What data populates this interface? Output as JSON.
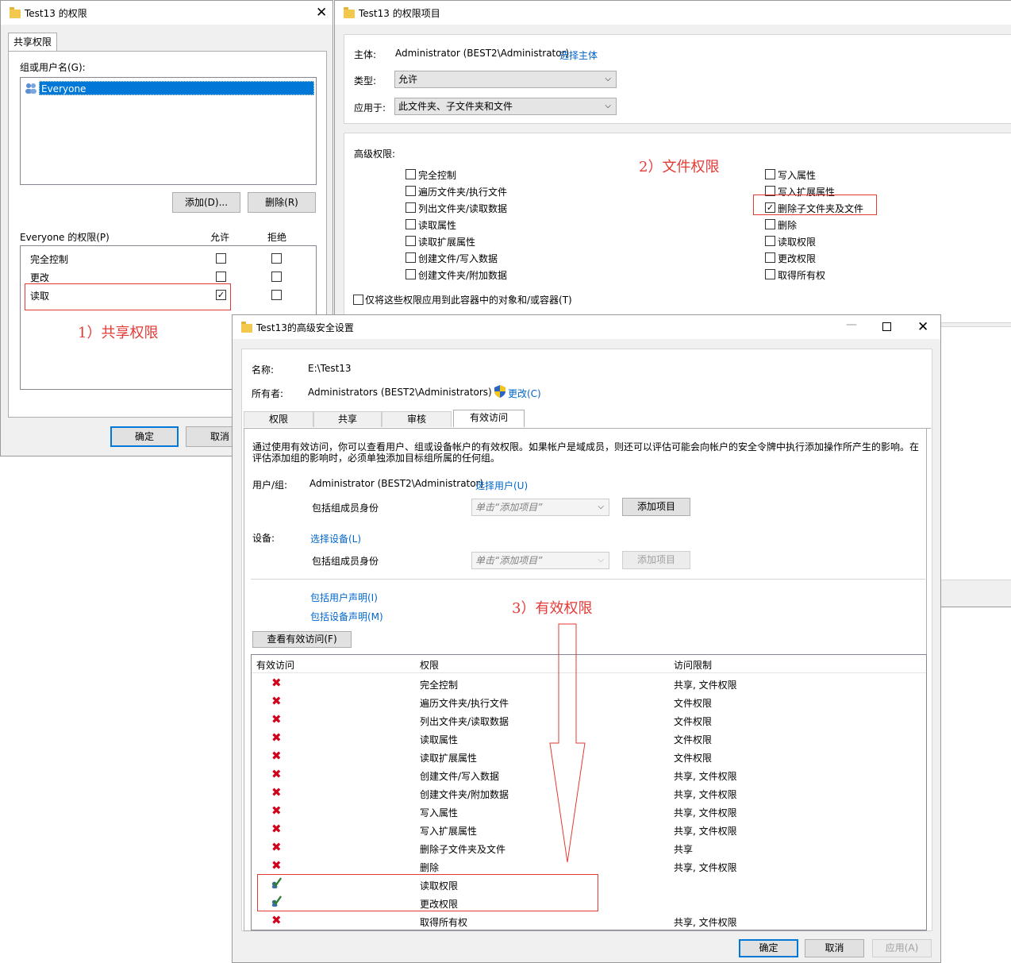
{
  "share_window": {
    "title": "Test13 的权限",
    "tab": "共享权限",
    "group_label": "组或用户名(G):",
    "users": [
      "Everyone"
    ],
    "add_button": "添加(D)...",
    "remove_button": "删除(R)",
    "perm_header": "Everyone 的权限(P)",
    "allow_header": "允许",
    "deny_header": "拒绝",
    "perms": [
      {
        "name": "完全控制",
        "allow": "",
        "deny": ""
      },
      {
        "name": "更改",
        "allow": "",
        "deny": ""
      },
      {
        "name": "读取",
        "allow": "✓",
        "deny": ""
      }
    ],
    "ok_button": "确定",
    "cancel_button": "取消",
    "annotation": "1）共享权限"
  },
  "entry_window": {
    "title": "Test13 的权限项目",
    "principal_label": "主体:",
    "principal_value": "Administrator (BEST2\\Administrator)",
    "select_principal": "选择主体",
    "type_label": "类型:",
    "type_value": "允许",
    "applies_label": "应用于:",
    "applies_value": "此文件夹、子文件夹和文件",
    "advanced_label": "高级权限:",
    "left_perms": [
      {
        "label": "完全控制",
        "mark": ""
      },
      {
        "label": "遍历文件夹/执行文件",
        "mark": ""
      },
      {
        "label": "列出文件夹/读取数据",
        "mark": ""
      },
      {
        "label": "读取属性",
        "mark": ""
      },
      {
        "label": "读取扩展属性",
        "mark": ""
      },
      {
        "label": "创建文件/写入数据",
        "mark": ""
      },
      {
        "label": "创建文件夹/附加数据",
        "mark": ""
      }
    ],
    "right_perms": [
      {
        "label": "写入属性",
        "mark": ""
      },
      {
        "label": "写入扩展属性",
        "mark": ""
      },
      {
        "label": "删除子文件夹及文件",
        "mark": "✓"
      },
      {
        "label": "删除",
        "mark": ""
      },
      {
        "label": "读取权限",
        "mark": ""
      },
      {
        "label": "更改权限",
        "mark": ""
      },
      {
        "label": "取得所有权",
        "mark": ""
      }
    ],
    "apply_only": "仅将这些权限应用到此容器中的对象和/或容器(T)",
    "annotation": "2）文件权限"
  },
  "adv_window": {
    "title": "Test13的高级安全设置",
    "name_label": "名称:",
    "name_value": "E:\\Test13",
    "owner_label": "所有者:",
    "owner_value": "Administrators (BEST2\\Administrators)",
    "change_link": "更改(C)",
    "tabs": [
      "权限",
      "共享",
      "审核",
      "有效访问"
    ],
    "description": "通过使用有效访问，你可以查看用户、组或设备帐户的有效权限。如果帐户是域成员，则还可以评估可能会向帐户的安全令牌中执行添加操作所产生的影响。在评估添加组的影响时，必须单独添加目标组所属的任何组。",
    "user_label": "用户/组:",
    "user_value": "Administrator (BEST2\\Administrator)",
    "select_user": "选择用户(U)",
    "include_group_label": "包括组成员身份",
    "select_placeholder": "单击“添加项目”",
    "add_item": "添加项目",
    "device_label": "设备:",
    "select_device": "选择设备(L)",
    "include_user_claims": "包括用户声明(I)",
    "include_device_claims": "包括设备声明(M)",
    "view_access": "查看有效访问(F)",
    "columns": [
      "有效访问",
      "权限",
      "访问限制"
    ],
    "rows": [
      {
        "access": "deny",
        "perm": "完全控制",
        "limit": "共享, 文件权限"
      },
      {
        "access": "deny",
        "perm": "遍历文件夹/执行文件",
        "limit": "文件权限"
      },
      {
        "access": "deny",
        "perm": "列出文件夹/读取数据",
        "limit": "文件权限"
      },
      {
        "access": "deny",
        "perm": "读取属性",
        "limit": "文件权限"
      },
      {
        "access": "deny",
        "perm": "读取扩展属性",
        "limit": "文件权限"
      },
      {
        "access": "deny",
        "perm": "创建文件/写入数据",
        "limit": "共享, 文件权限"
      },
      {
        "access": "deny",
        "perm": "创建文件夹/附加数据",
        "limit": "共享, 文件权限"
      },
      {
        "access": "deny",
        "perm": "写入属性",
        "limit": "共享, 文件权限"
      },
      {
        "access": "deny",
        "perm": "写入扩展属性",
        "limit": "共享, 文件权限"
      },
      {
        "access": "deny",
        "perm": "删除子文件夹及文件",
        "limit": "共享"
      },
      {
        "access": "deny",
        "perm": "删除",
        "limit": "共享, 文件权限"
      },
      {
        "access": "allow",
        "perm": "读取权限",
        "limit": ""
      },
      {
        "access": "allow",
        "perm": "更改权限",
        "limit": ""
      },
      {
        "access": "deny",
        "perm": "取得所有权",
        "limit": "共享, 文件权限"
      }
    ],
    "ok_button": "确定",
    "cancel_button": "取消",
    "apply_button": "应用(A)",
    "annotation": "3）有效权限",
    "colors": {
      "deny": "#d0021b",
      "allow": "#2e7d32",
      "annotation": "#e53935"
    }
  }
}
